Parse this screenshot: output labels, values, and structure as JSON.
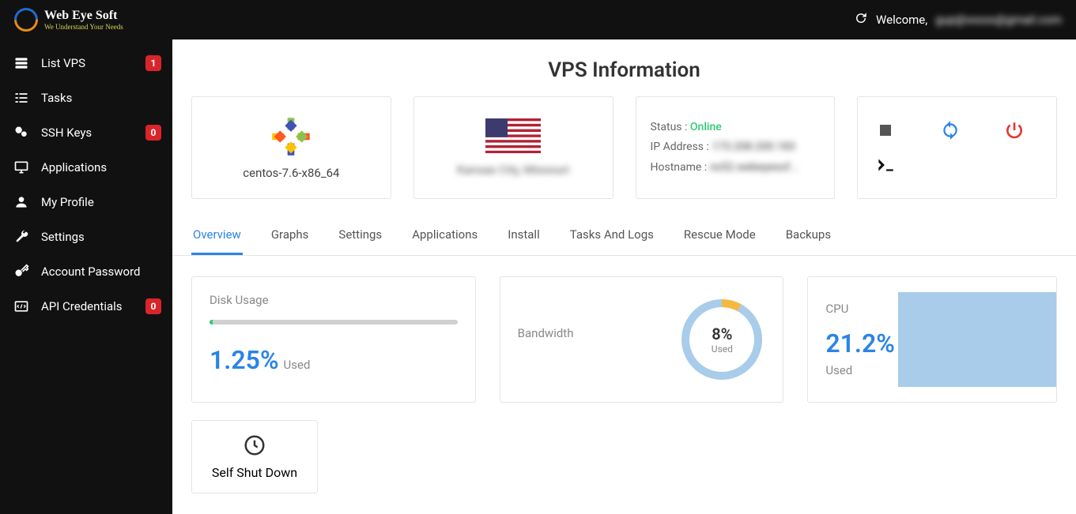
{
  "header": {
    "brand_main": "Web Eye Soft",
    "brand_sub": "We Understand Your Needs",
    "welcome_prefix": "Welcome,",
    "welcome_user": "gup@xxxxx@gmail.com"
  },
  "sidebar": {
    "items": [
      {
        "label": "List VPS",
        "badge": "1"
      },
      {
        "label": "Tasks"
      },
      {
        "label": "SSH Keys",
        "badge": "0"
      },
      {
        "label": "Applications"
      },
      {
        "label": "My Profile"
      },
      {
        "label": "Settings"
      },
      {
        "label": "Account Password"
      },
      {
        "label": "API Credentials",
        "badge": "0"
      }
    ]
  },
  "page": {
    "title": "VPS Information"
  },
  "vps": {
    "os_label": "centos-7.6-x86_64",
    "location": "Kansas City, Missouri",
    "status_label": "Status :",
    "status_value": "Online",
    "ip_label": "IP Address :",
    "ip_value": "173.208.200.183",
    "hostname_label": "Hostname :",
    "hostname_value": "ns52.webeyesof..."
  },
  "tabs": [
    "Overview",
    "Graphs",
    "Settings",
    "Applications",
    "Install",
    "Tasks And Logs",
    "Rescue Mode",
    "Backups"
  ],
  "metrics": {
    "disk": {
      "title": "Disk Usage",
      "value": "1.25%",
      "used_label": "Used",
      "percent_num": 1.25
    },
    "bandwidth": {
      "title": "Bandwidth",
      "value": "8%",
      "used_label": "Used",
      "percent_num": 8
    },
    "cpu": {
      "title": "CPU",
      "value": "21.2%",
      "used_label": "Used"
    }
  },
  "actions": {
    "self_shutdown": "Self Shut Down"
  }
}
